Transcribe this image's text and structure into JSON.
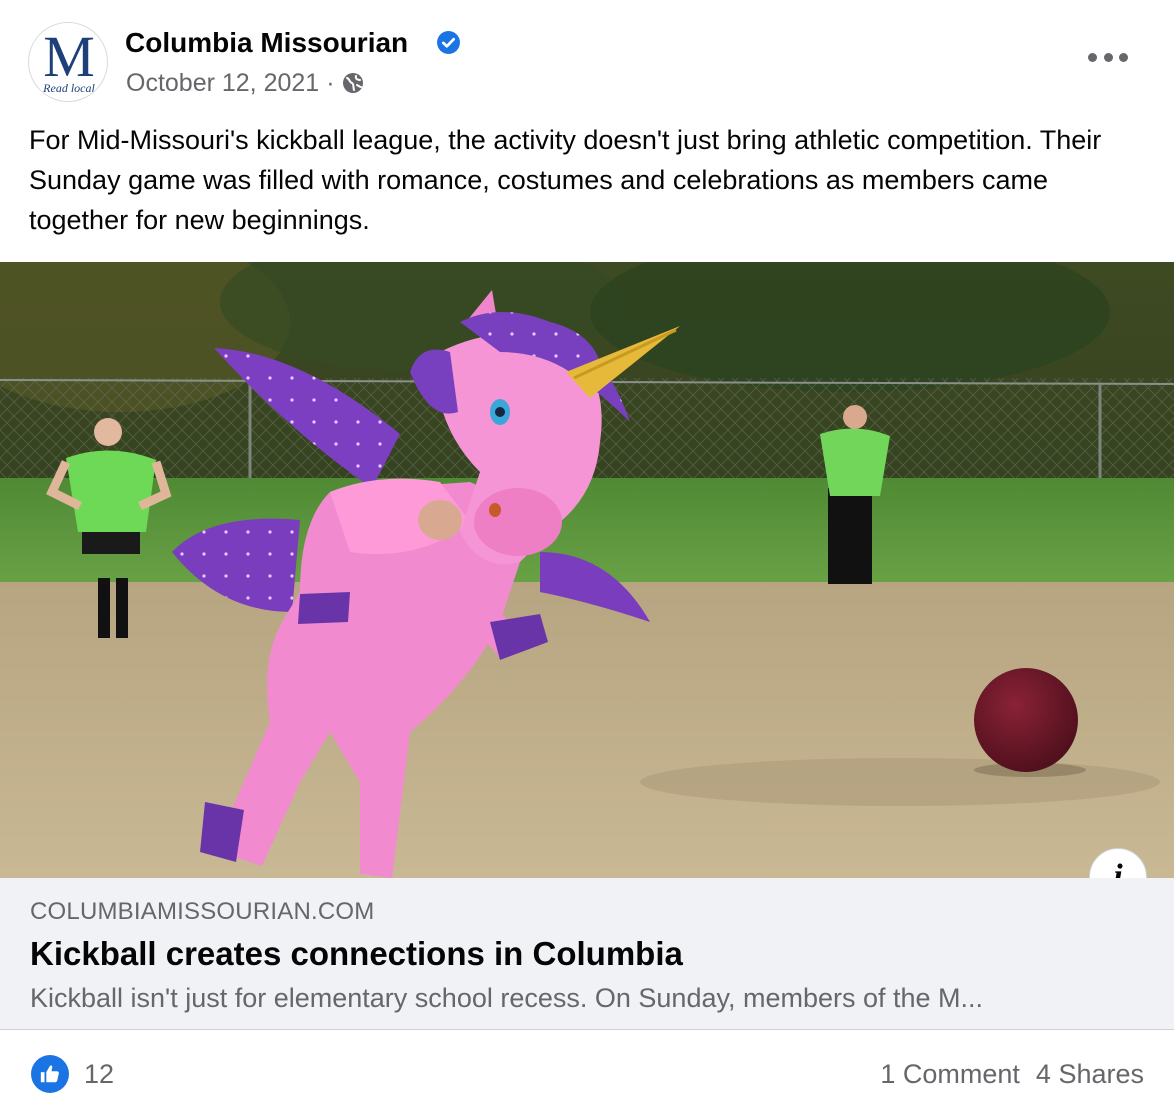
{
  "post": {
    "page_name": "Columbia Missourian",
    "avatar_letter": "M",
    "avatar_tagline": "Read local",
    "date": "October 12, 2021",
    "date_separator": "·",
    "caption": "For Mid-Missouri's kickball league, the activity doesn't just bring athletic competition. Their Sunday game was filled with romance, costumes and celebrations as members came together for new beginnings."
  },
  "icons": {
    "verified": "verified-badge-icon",
    "audience": "globe-icon",
    "more": "more-options-icon",
    "info": "info-icon",
    "like": "like-thumb-icon"
  },
  "colors": {
    "facebook_blue": "#1b74e4",
    "secondary_text": "#65676b",
    "link_bg": "#f0f2f5"
  },
  "photo": {
    "description_visible": false
  },
  "info_button_label": "i",
  "link_preview": {
    "domain": "COLUMBIAMISSOURIAN.COM",
    "title": "Kickball creates connections in Columbia",
    "description": "Kickball isn't just for elementary school recess. On Sunday, members of the M..."
  },
  "reactions": {
    "like_count": "12",
    "comments": "1 Comment",
    "shares": "4 Shares"
  }
}
